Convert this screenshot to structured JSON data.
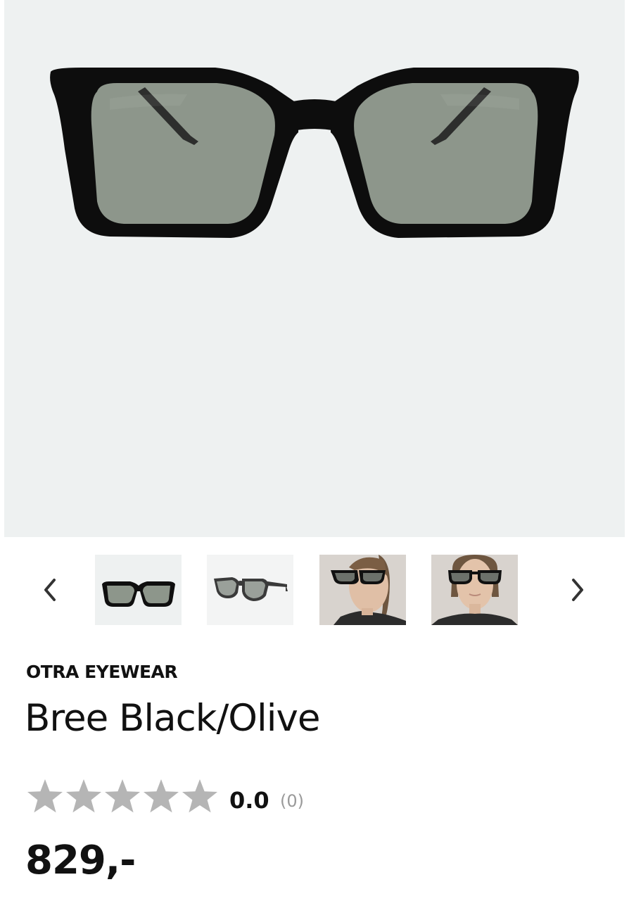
{
  "product": {
    "brand": "OTRA EYEWEAR",
    "name": "Bree Black/Olive",
    "rating_value": "0.0",
    "rating_count": "(0)",
    "rating_stars_filled": 0,
    "rating_stars_total": 5,
    "price": "829,-"
  },
  "gallery": {
    "prev_icon": "chevron-left-icon",
    "next_icon": "chevron-right-icon",
    "thumbnails": [
      {
        "subject": "sunglasses-front"
      },
      {
        "subject": "sunglasses-angle"
      },
      {
        "subject": "model-side"
      },
      {
        "subject": "model-front"
      }
    ]
  },
  "colors": {
    "hero_bg": "#eef1f1",
    "frame": "#0d0d0d",
    "lens": "#8d968b",
    "star_empty": "#b5b5b5"
  }
}
